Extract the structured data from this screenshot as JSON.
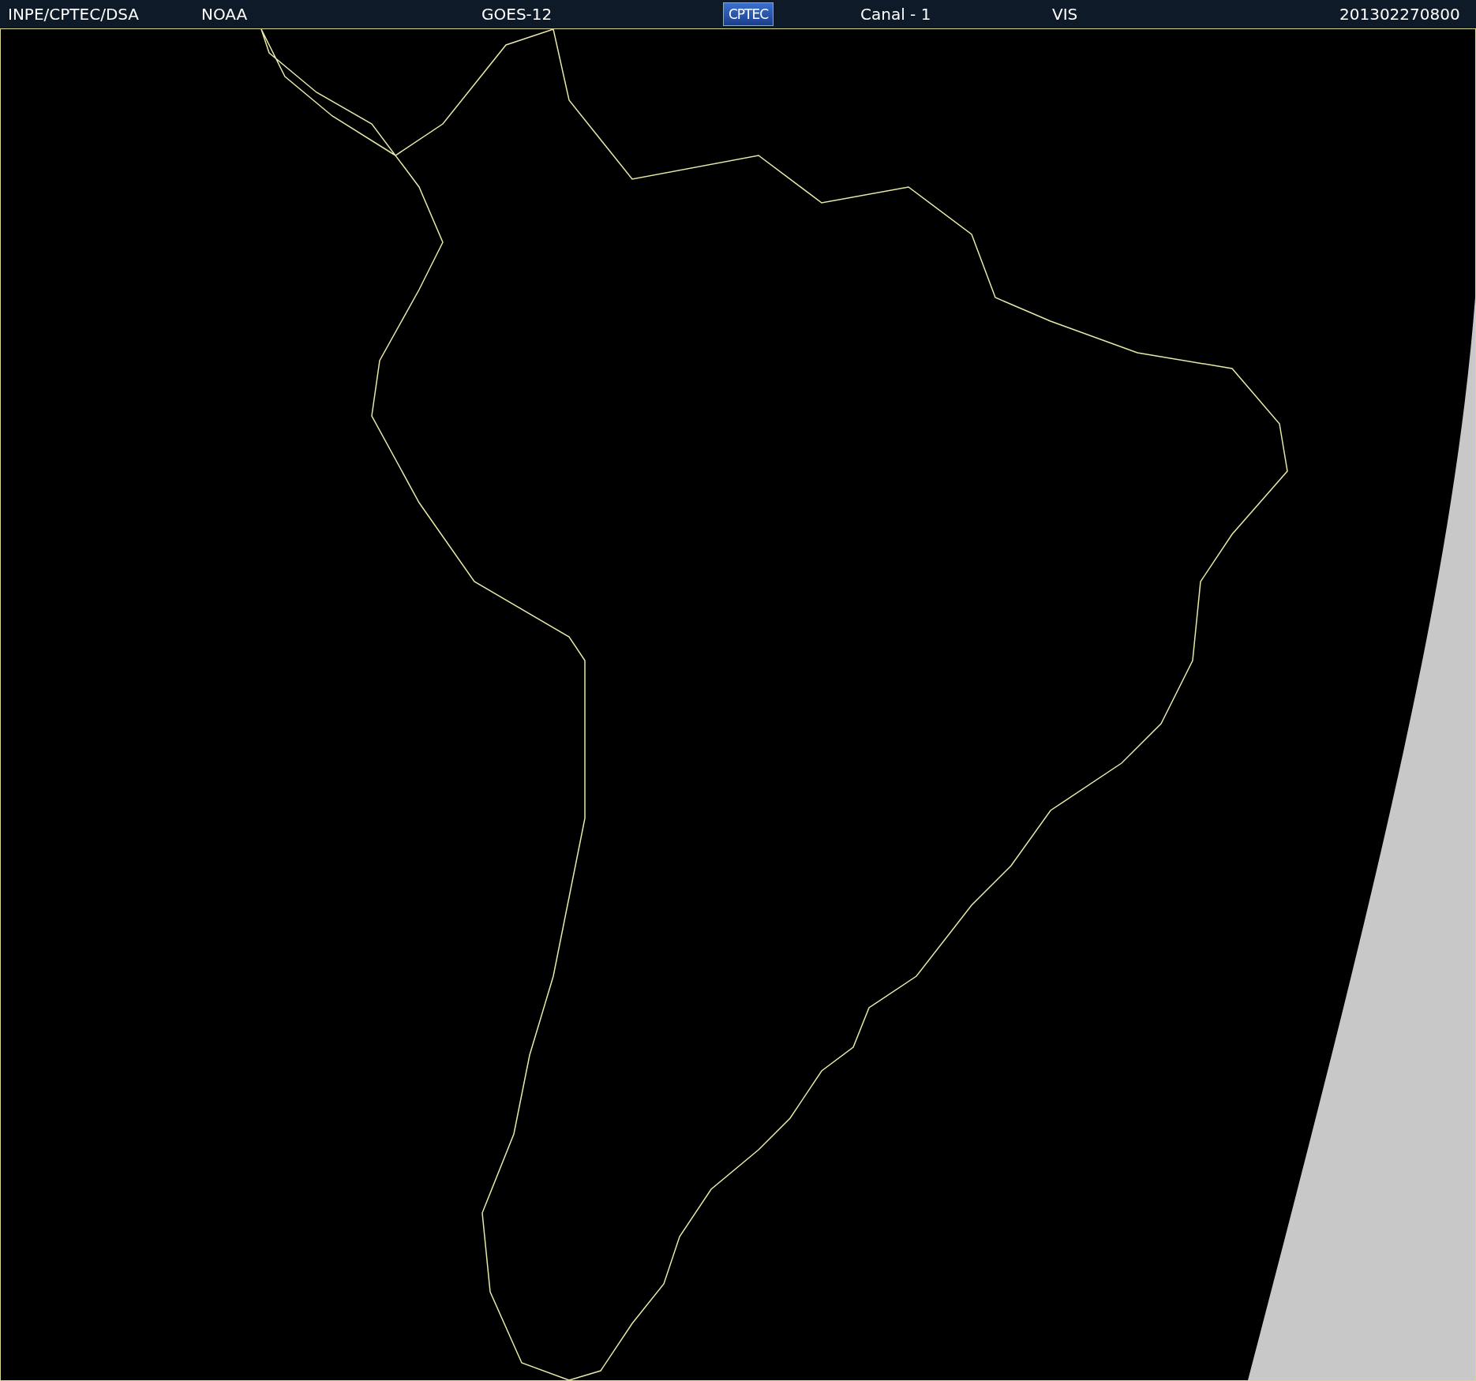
{
  "header": {
    "items": [
      {
        "kind": "text",
        "text": "INPE/CPTEC/DSA"
      },
      {
        "kind": "text",
        "text": "NOAA"
      },
      {
        "kind": "text",
        "text": "GOES-12"
      },
      {
        "kind": "logo",
        "text": "CPTEC"
      },
      {
        "kind": "text",
        "text": "Canal - 1"
      },
      {
        "kind": "text",
        "text": "VIS"
      },
      {
        "kind": "text",
        "text": "201302270800"
      }
    ]
  }
}
